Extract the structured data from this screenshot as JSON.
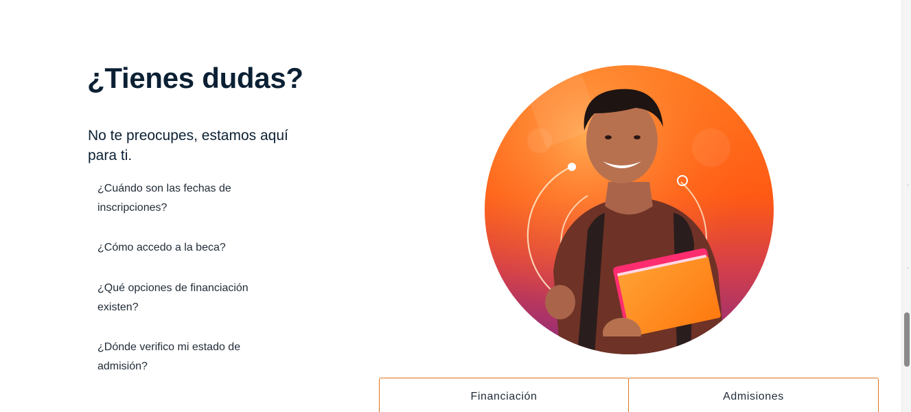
{
  "section": {
    "title": "¿Tienes dudas?",
    "subtitle": "No te preocupes, estamos aquí para ti."
  },
  "faq": {
    "items": [
      {
        "label": "¿Cuándo son las fechas de inscripciones?"
      },
      {
        "label": "¿Cómo accedo a la beca?"
      },
      {
        "label": "¿Qué opciones de financiación existen?"
      },
      {
        "label": "¿Dónde verifico mi estado de admisión?"
      }
    ]
  },
  "tabs": [
    {
      "label": "Financiación"
    },
    {
      "label": "Admisiones"
    }
  ],
  "colors": {
    "heading": "#0b2033",
    "accent_border": "#e0731c",
    "photo_orange": "#ff6a1a",
    "photo_purple": "#8b2a7d"
  }
}
